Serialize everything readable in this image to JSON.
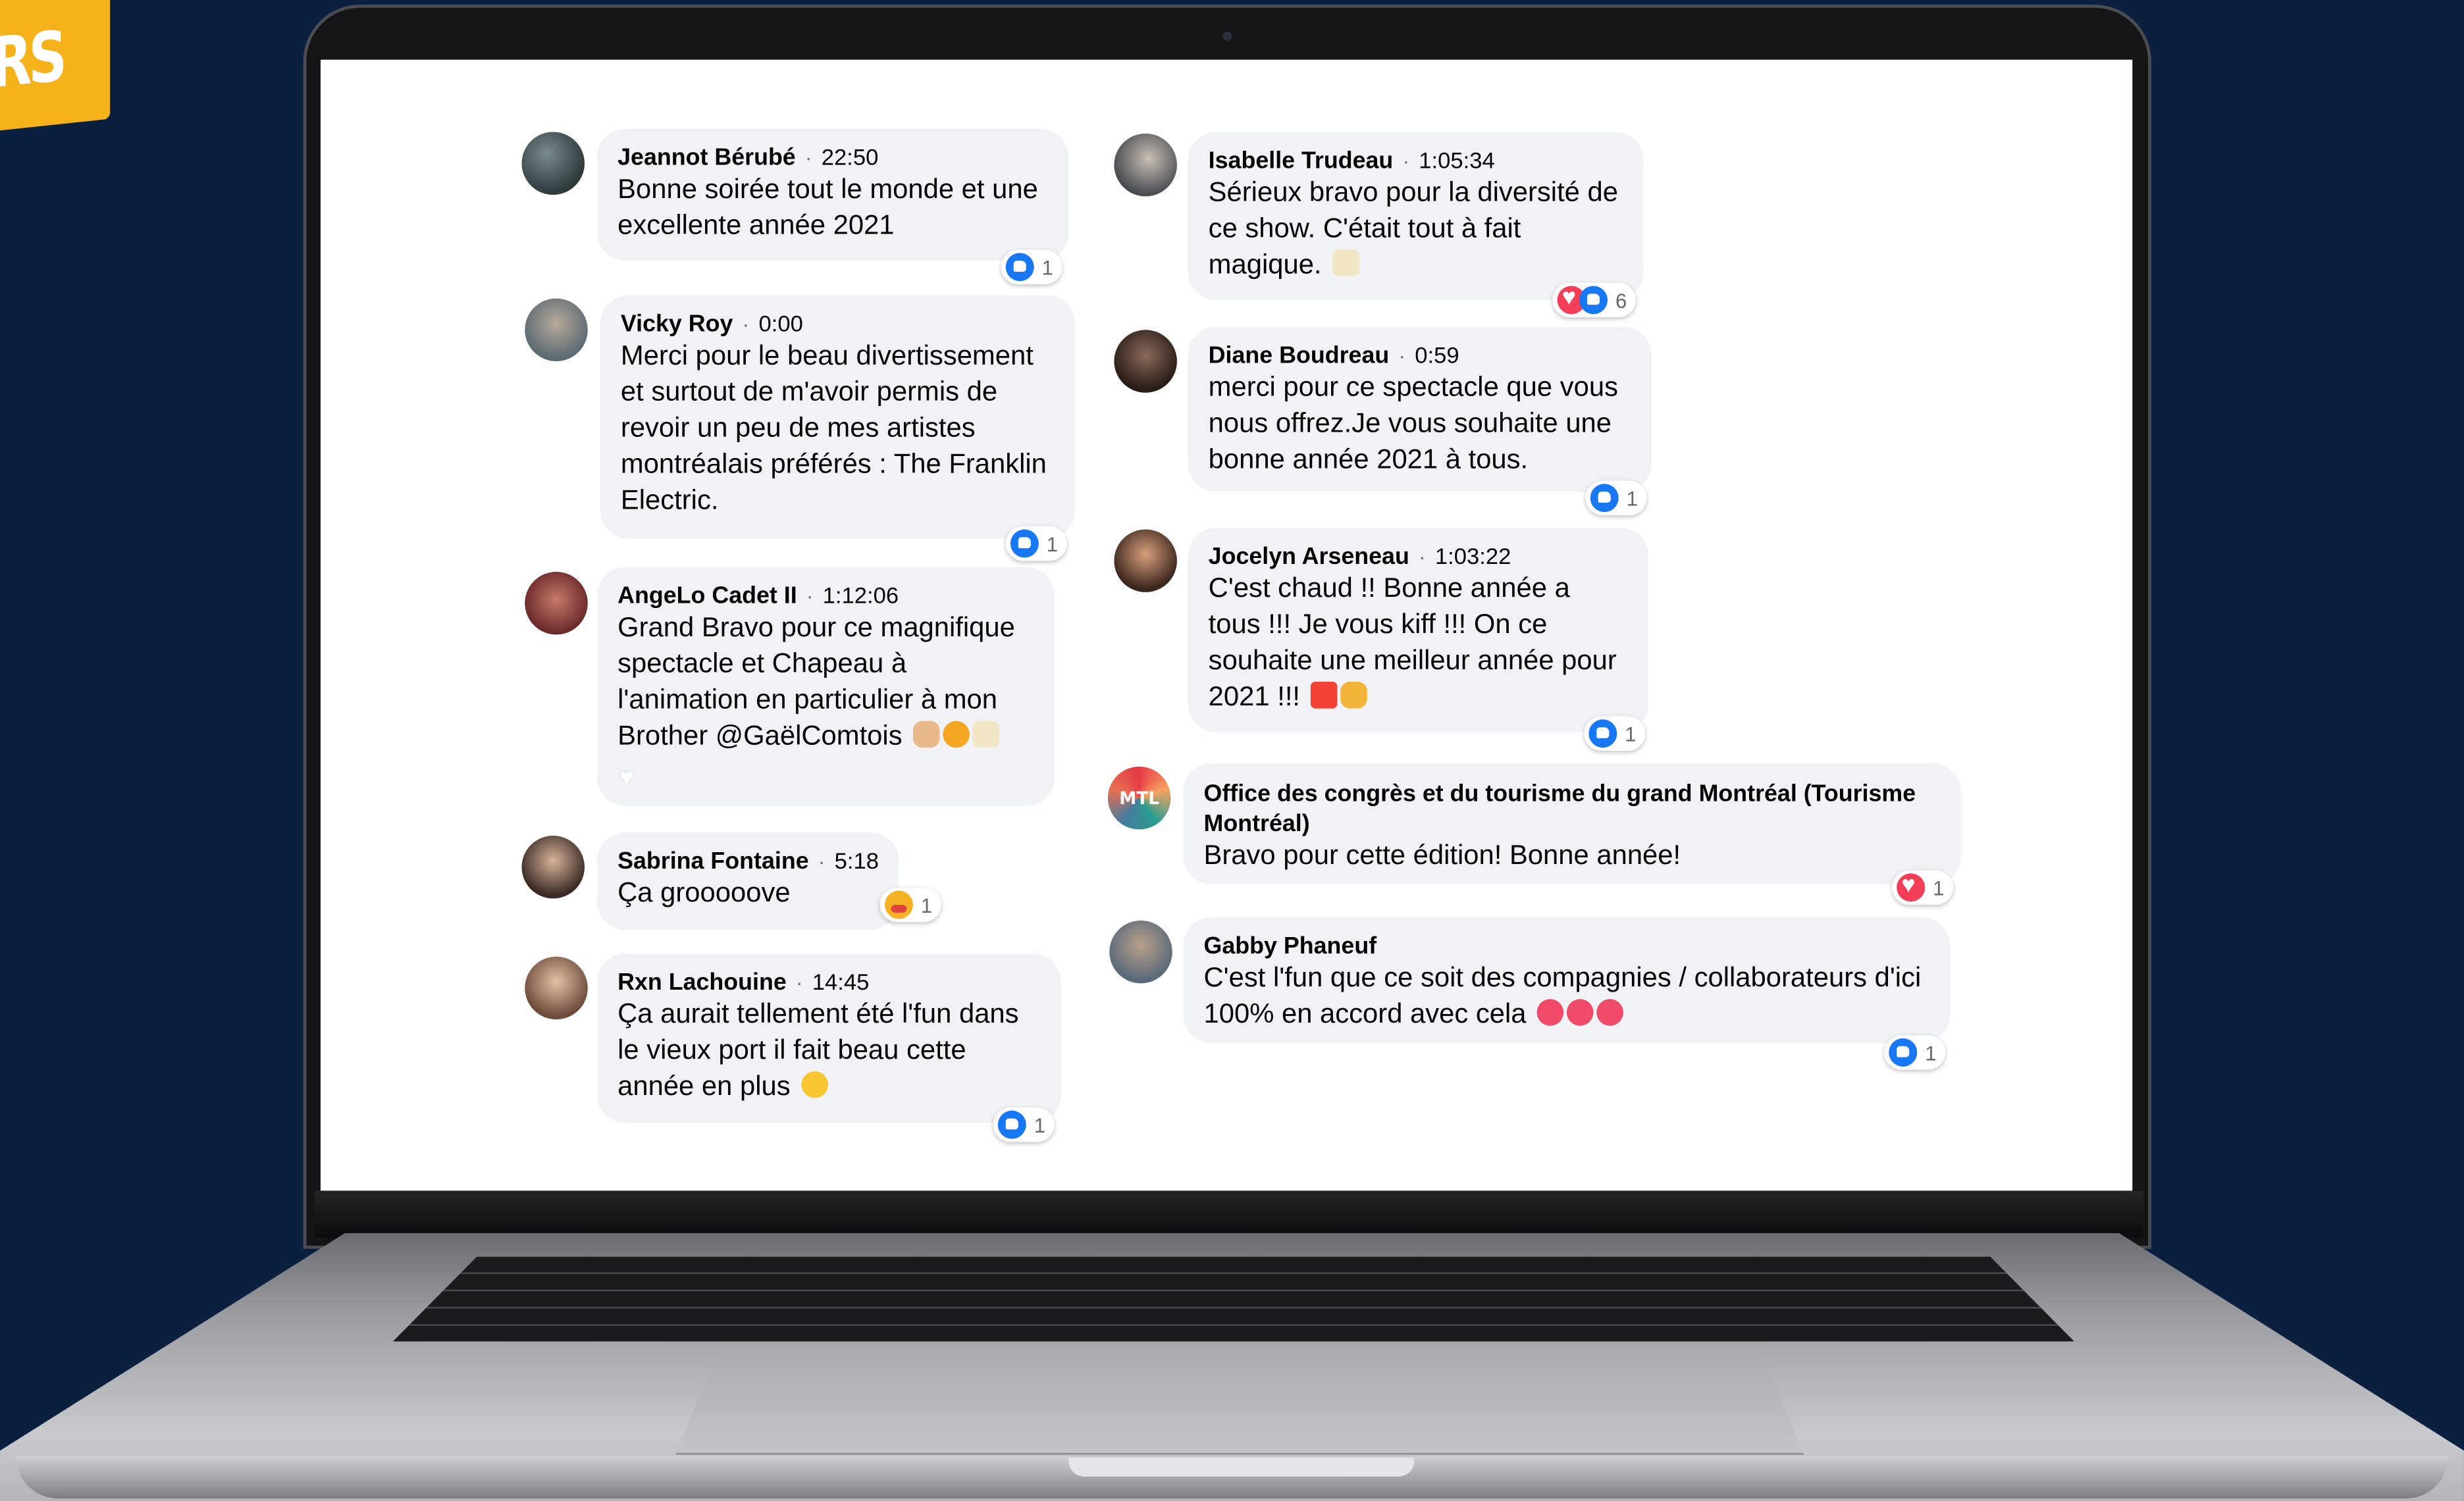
{
  "banner": {
    "text": "RS",
    "color": "#f6b21a"
  },
  "colors": {
    "background": "#0b1f3f",
    "bubble": "#f0f2f5",
    "like": "#1877f2",
    "love": "#f33e58"
  },
  "comments_left": [
    {
      "author": "Jeannot Bérubé",
      "time": "22:50",
      "text": "Bonne soirée tout le monde et une excellente année 2021",
      "reactions": [
        "like"
      ],
      "count": "1"
    },
    {
      "author": "Vicky Roy",
      "time": "0:00",
      "text": "Merci pour le beau divertissement et surtout de m'avoir permis de revoir un peu de mes artistes montréalais préférés : The Franklin Electric.",
      "reactions": [
        "like"
      ],
      "count": "1"
    },
    {
      "author": "AngeLo Cadet II",
      "time": "1:12:06",
      "text": "Grand Bravo pour ce magnifique spectacle et Chapeau à l'animation en particulier à mon Brother @GaëlComtois",
      "emojis": [
        "ok-hand",
        "heart-eyes-cat",
        "clinking-glasses"
      ],
      "reactions": [
        "heart-outline"
      ]
    },
    {
      "author": "Sabrina Fontaine",
      "time": "5:18",
      "text": "Ça grooooove",
      "reactions": [
        "care"
      ],
      "count": "1"
    },
    {
      "author": "Rxn Lachouine",
      "time": "14:45",
      "text": "Ça aurait tellement été l'fun dans le vieux port il fait beau cette année en plus",
      "emojis": [
        "grinning-face"
      ],
      "reactions": [
        "like"
      ],
      "count": "1"
    }
  ],
  "comments_right": [
    {
      "author": "Isabelle Trudeau",
      "time": "1:05:34",
      "text": "Sérieux bravo pour la diversité de ce show. C'était tout à fait magique.",
      "emojis": [
        "clinking-glasses"
      ],
      "reactions": [
        "love",
        "like"
      ],
      "count": "6"
    },
    {
      "author": "Diane Boudreau",
      "time": "0:59",
      "text": "merci pour ce spectacle que vous nous offrez.Je vous souhaite une bonne année 2021 à tous.",
      "reactions": [
        "like"
      ],
      "count": "1"
    },
    {
      "author": "Jocelyn Arseneau",
      "time": "1:03:22",
      "text": "C'est chaud !! Bonne année a tous !!! Je vous kiff !!! On ce souhaite une meilleur année pour 2021 !!!",
      "emojis": [
        "hundred-points",
        "folded-hands"
      ],
      "reactions": [
        "like"
      ],
      "count": "1"
    },
    {
      "author": "Office des congrès et du tourisme du grand Montréal (Tourisme Montréal)",
      "avatar_text": "MTL",
      "text": "Bravo pour cette édition! Bonne année!",
      "reactions": [
        "love"
      ],
      "count": "1"
    },
    {
      "author": "Gabby Phaneuf",
      "text": "C'est l'fun que ce soit des compagnies / collaborateurs d'ici 100% en accord avec cela",
      "emojis": [
        "heart",
        "heart",
        "heart"
      ],
      "reactions": [
        "like"
      ],
      "count": "1"
    }
  ]
}
